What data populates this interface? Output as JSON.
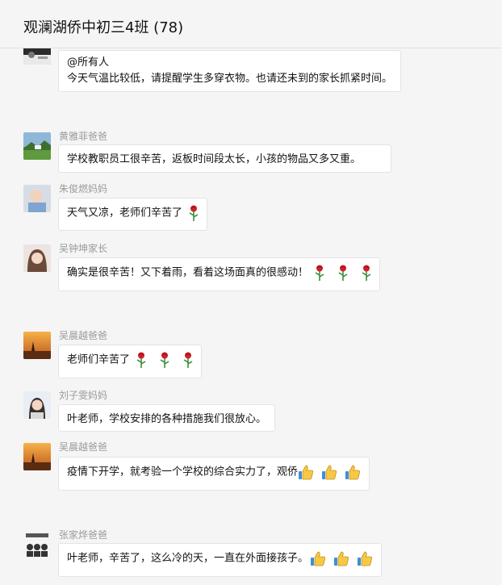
{
  "window": {
    "title": "观澜湖侨中初三4班 (78)"
  },
  "messages": [
    {
      "sender": "",
      "avatar": "teacher-avatar",
      "lines": [
        "@所有人",
        "今天气温比较低，请提醒学生多穿衣物。也请还未到的家长抓紧时间。"
      ],
      "emojis": []
    },
    {
      "sender": "黄雅菲爸爸",
      "avatar": "landscape-avatar",
      "lines": [
        "学校教职员工很辛苦，返板时间段太长，小孩的物品又多又重。"
      ],
      "emojis": []
    },
    {
      "sender": "朱俊燃妈妈",
      "avatar": "child-avatar",
      "lines": [
        "天气又凉，老师们辛苦了"
      ],
      "emojis": [
        "rose-icon"
      ]
    },
    {
      "sender": "吴钟坤家长",
      "avatar": "portrait-avatar",
      "lines": [
        "确实是很辛苦！又下着雨，看着这场面真的很感动！"
      ],
      "emojis": [
        "rose-icon",
        "rose-icon",
        "rose-icon"
      ]
    },
    {
      "sender": "吴晨越爸爸",
      "avatar": "sunset-avatar",
      "lines": [
        "老师们辛苦了"
      ],
      "emojis": [
        "rose-icon",
        "rose-icon",
        "rose-icon"
      ]
    },
    {
      "sender": "刘子雯妈妈",
      "avatar": "woman-avatar",
      "lines": [
        "叶老师，学校安排的各种措施我们很放心。"
      ],
      "emojis": []
    },
    {
      "sender": "吴晨越爸爸",
      "avatar": "sunset-avatar",
      "lines": [
        "疫情下开学，就考验一个学校的综合实力了，观侨"
      ],
      "emojis": [
        "thumbs-up-icon",
        "thumbs-up-icon",
        "thumbs-up-icon"
      ]
    },
    {
      "sender": "张家烨爸爸",
      "avatar": "poster-avatar",
      "lines": [
        "叶老师，辛苦了，这么冷的天，一直在外面接孩子。"
      ],
      "emojis": [
        "thumbs-up-icon",
        "thumbs-up-icon",
        "thumbs-up-icon"
      ]
    }
  ]
}
